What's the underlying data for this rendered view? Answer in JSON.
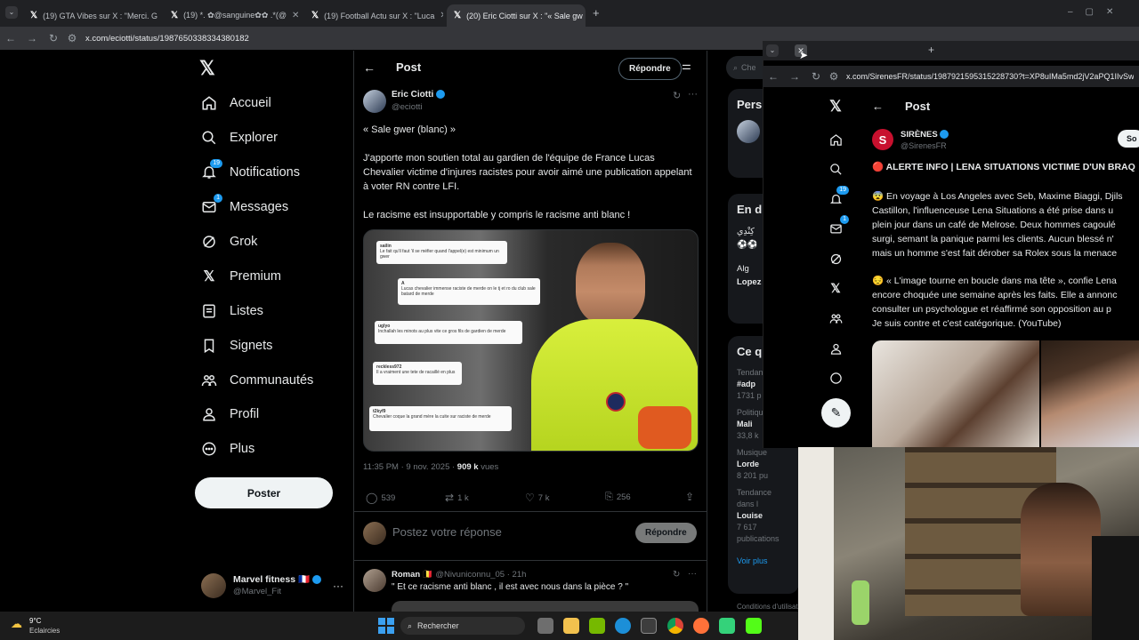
{
  "browser": {
    "tabs": [
      {
        "title": "(19) GTA Vibes sur X : \"Merci. G"
      },
      {
        "title": "(19) *. ✿@sanguine✿✿ .*(@"
      },
      {
        "title": "(19) Football Actu sur X : \"Luca"
      },
      {
        "title": "(20) Eric Ciotti sur X : \"« Sale gw"
      }
    ],
    "url": "x.com/eciotti/status/1987650338334380182"
  },
  "nav": {
    "items": [
      {
        "label": "Accueil"
      },
      {
        "label": "Explorer"
      },
      {
        "label": "Notifications",
        "badge": "19"
      },
      {
        "label": "Messages",
        "badge": "1"
      },
      {
        "label": "Grok"
      },
      {
        "label": "Premium"
      },
      {
        "label": "Listes"
      },
      {
        "label": "Signets"
      },
      {
        "label": "Communautés"
      },
      {
        "label": "Profil"
      },
      {
        "label": "Plus"
      }
    ],
    "post_button": "Poster",
    "account": {
      "name": "Marvel fitness 🇫🇷",
      "handle": "@Marvel_Fit"
    }
  },
  "header": {
    "title": "Post",
    "reply_button": "Répondre"
  },
  "post": {
    "author": "Eric Ciotti",
    "handle": "@eciotti",
    "quote_title": "« Sale gwer (blanc) »",
    "paragraph1": "J'apporte mon soutien total au gardien de l'équipe de France Lucas Chevalier victime d'injures racistes pour avoir aimé une publication appelant à voter RN contre LFI.",
    "paragraph2": "Le racisme est insupportable y compris le racisme anti blanc !",
    "time": "11:35 PM · 9 nov. 2025 · ",
    "views_count": "909 k",
    "views_label": " vues",
    "stats": {
      "replies": "539",
      "reposts": "1 k",
      "likes": "7 k",
      "bookmarks": "256"
    },
    "screenshots": [
      {
        "name": "sailin",
        "text": "Le fait qu'il faut 'il se méfier quand l'appel(e) est minimum un gwer"
      },
      {
        "name": "A",
        "text": "Lucas chevalier immense raciste de merde on le tj et ro du club sale batard de merde"
      },
      {
        "name": "uglyo",
        "text": "Inchallah les minots au plus vite ce gros fils de gardien de merde"
      },
      {
        "name": "reckless972",
        "text": "Il a vraiment une tete de racaillé en plus"
      },
      {
        "name": "t2kyf9",
        "text": "Chevalier coque la grand mère la cuite sur raciste de merde"
      }
    ]
  },
  "compose": {
    "placeholder": "Postez votre réponse",
    "button": "Répondre"
  },
  "reply": {
    "author": "Roman 🇧🇪",
    "meta": "@Nivuniconnu_05 · 21h",
    "text": "\" Et ce racisme anti blanc , il est avec nous dans la pièce ? \""
  },
  "right_col": {
    "search_placeholder": "Che",
    "premium_title": "Pers",
    "trends_title": "En d",
    "trend_lines": [
      "كِنْدِي",
      "⚽⚽",
      "Alg",
      "Lopez"
    ],
    "ce_title": "Ce q",
    "items": [
      {
        "cat": "Tendan",
        "name": "#adp",
        "count": "1731 p"
      },
      {
        "cat": "Politiqu",
        "name": "Mali",
        "count": "33,8 k"
      },
      {
        "cat": "Musique",
        "name": "Lorde",
        "count": "8 201 pu"
      },
      {
        "cat": "Tendance dans l",
        "name": "Louise",
        "count": "7 617 publications"
      }
    ],
    "voir_plus": "Voir plus",
    "footer": "Conditions d'utilisat"
  },
  "overlay": {
    "url": "x.com/SirenesFR/status/1987921595315228730?t=XP8uIMa5md2jV2aPQ1IIvSw",
    "header_title": "Post",
    "author": "SIRÈNES",
    "handle": "@SirenesFR",
    "follow_btn": "So",
    "lines": [
      "🔴 ALERTE INFO | LENA SITUATIONS VICTIME D'UN BRAQ",
      "😨 En voyage à Los Angeles avec Seb, Maxime Biaggi, Djils",
      "Castillon, l'influenceuse Lena Situations a été prise dans u",
      "plein jour dans un café de Melrose. Deux hommes cagoulé",
      "surgi, semant la panique parmi les clients. Aucun blessé n'",
      "mais un homme s'est fait dérober sa Rolex sous la menace",
      "😔 « L'image tourne en boucle dans ma tête », confie Lena",
      "encore choquée une semaine après les faits. Elle a annonc",
      "consulter un psychologue et réaffirmé son opposition au p",
      "Je suis contre et c'est catégorique. (YouTube)"
    ],
    "badges": {
      "notif": "19",
      "msg": "1"
    }
  },
  "taskbar": {
    "weather_temp": "9°C",
    "weather_text": "Eclaircies",
    "search": "Rechercher"
  },
  "colors": {
    "accent": "#1d9bf0",
    "bg": "#000000",
    "border": "#2f3336",
    "muted": "#71767b"
  }
}
